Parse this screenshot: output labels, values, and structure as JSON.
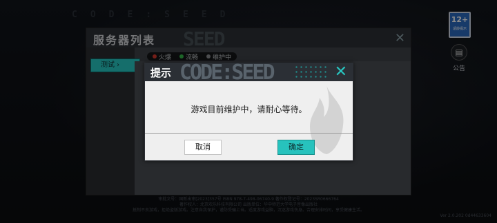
{
  "background": {
    "game_title": "CODE:SEED",
    "age_rating": {
      "age": "12+",
      "label": "适龄提示"
    },
    "notice_label": "公告",
    "legal_lines": [
      "审批文号：国新出审[2023]357号 ISBN 978-7-498-06740-9 著作权登记号：2023SR0666764",
      "著作权人：北京欢乐科技有限公司 出版单位：华中师范大学电子音像出版社",
      "抵制不良游戏，拒绝盗版游戏。注意自我保护，谨防受骗上当。适度游戏益脑，沉迷游戏伤身。合理安排时间，享受健康生活。"
    ],
    "version": "Ver 2.0.202 0d44633604"
  },
  "server_panel": {
    "title": "服务器列表",
    "title_watermark": "SEED",
    "tab_test": "测试",
    "legend": [
      {
        "label": "火爆",
        "color": "#d63a2f"
      },
      {
        "label": "流畅",
        "color": "#35b84a"
      },
      {
        "label": "维护中",
        "color": "#8a8d91"
      }
    ]
  },
  "dialog": {
    "title": "提示",
    "watermark": "CODE:SEED",
    "message": "游戏目前维护中，请耐心等待。",
    "cancel_label": "取消",
    "ok_label": "确定",
    "accent": "#27c2bd"
  }
}
